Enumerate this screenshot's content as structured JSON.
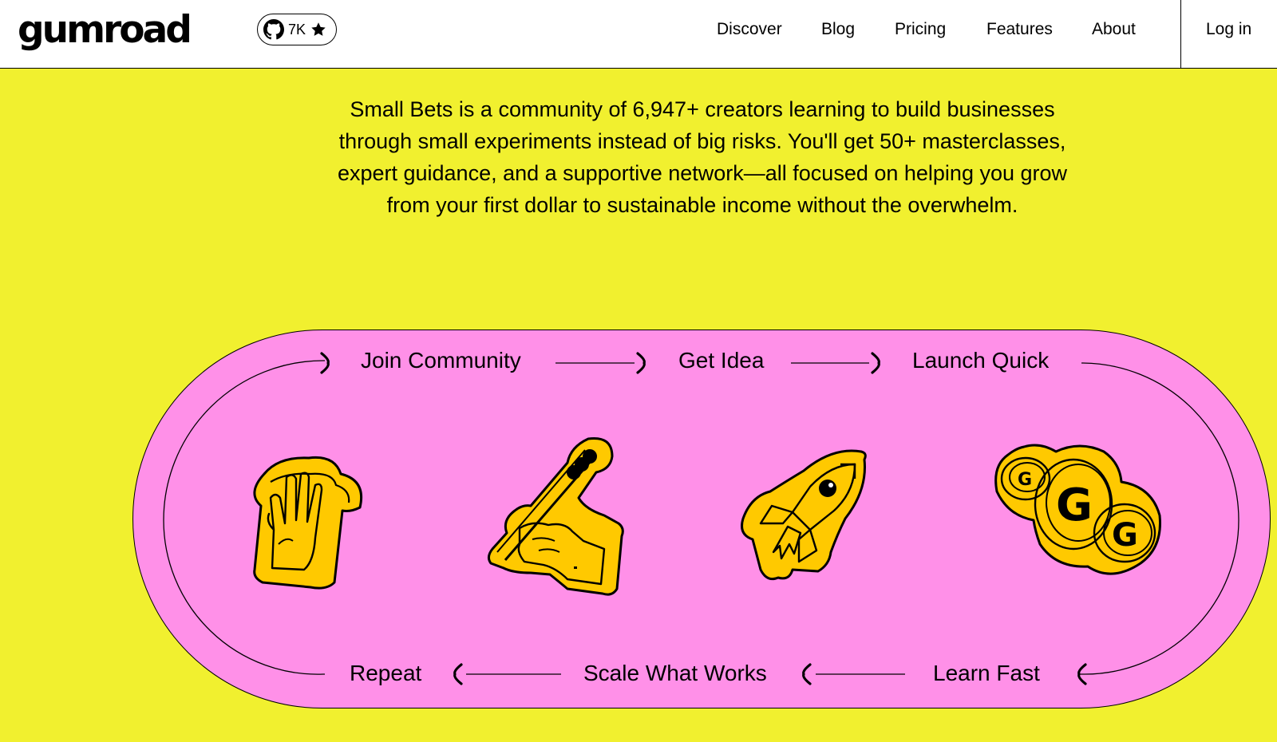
{
  "header": {
    "logo_text": "gumroad",
    "github": {
      "icon": "github-icon",
      "count": "7K",
      "star_icon": "star-icon"
    },
    "nav": [
      "Discover",
      "Blog",
      "Pricing",
      "Features",
      "About"
    ],
    "login_label": "Log in"
  },
  "main": {
    "description": "Small Bets is a community of 6,947+ creators learning to build businesses through small experiments instead of big risks. You'll get 50+ masterclasses, expert guidance, and a supportive network—all focused on helping you grow from your first dollar to sustainable income without the overwhelm.",
    "cycle": {
      "steps_top": [
        "Join Community",
        "Get Idea",
        "Launch Quick"
      ],
      "steps_bottom": [
        "Repeat",
        "Scale What Works",
        "Learn Fast"
      ],
      "icons": [
        "raised-hand-icon",
        "hand-writing-pencil-icon",
        "rocket-icon",
        "gumroad-coins-icon"
      ]
    }
  },
  "colors": {
    "page_background": "#F1F02F",
    "cycle_background": "#FF90E8",
    "sticker_fill": "#FFC900",
    "header_background": "#FFFFFF"
  }
}
